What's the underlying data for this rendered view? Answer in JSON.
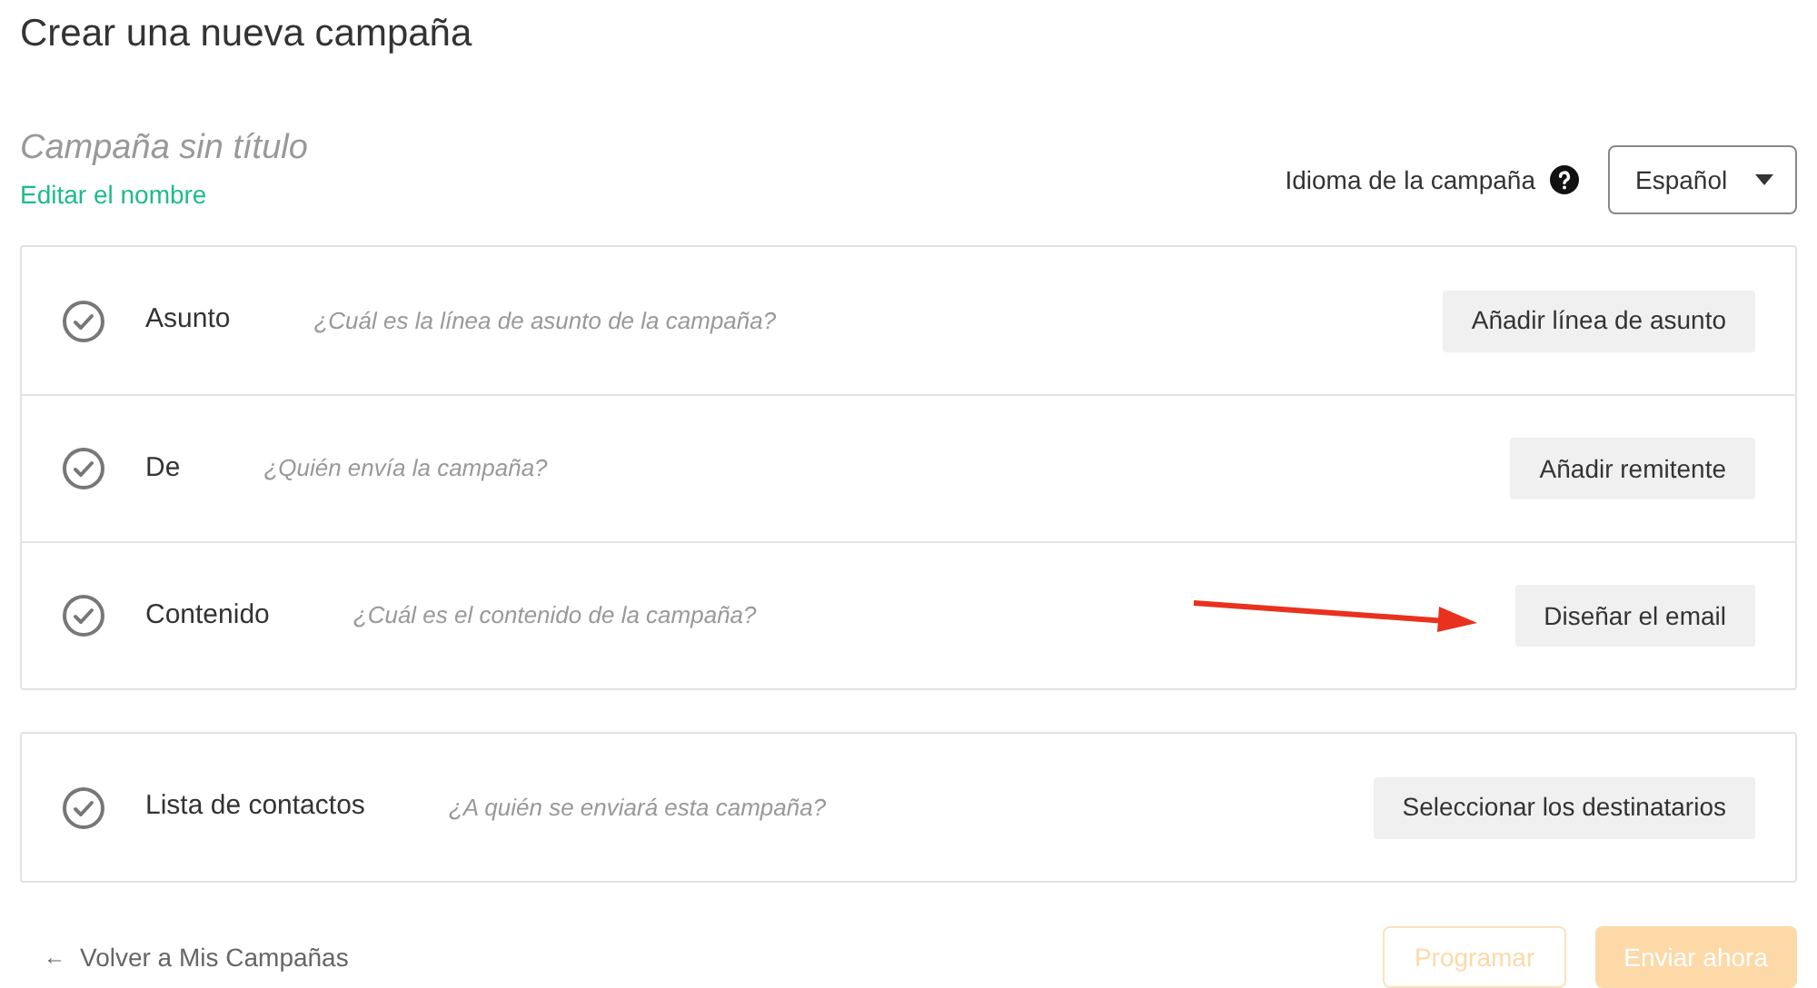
{
  "page_title": "Crear una nueva campaña",
  "campaign": {
    "name_placeholder": "Campaña sin título",
    "edit_link": "Editar el nombre"
  },
  "language": {
    "label": "Idioma de la campaña",
    "value": "Español"
  },
  "sections": [
    {
      "rows": [
        {
          "label": "Asunto",
          "hint": "¿Cuál es la línea de asunto de la campaña?",
          "button": "Añadir línea de asunto",
          "arrow": false
        },
        {
          "label": "De",
          "hint": "¿Quién envía la campaña?",
          "button": "Añadir remitente",
          "arrow": false
        },
        {
          "label": "Contenido",
          "hint": "¿Cuál es el contenido de la campaña?",
          "button": "Diseñar el email",
          "arrow": true
        }
      ]
    },
    {
      "rows": [
        {
          "label": "Lista de contactos",
          "hint": "¿A quién se enviará esta campaña?",
          "button": "Seleccionar los destinatarios",
          "arrow": false
        }
      ]
    }
  ],
  "footer": {
    "back_link": "Volver a Mis Campañas",
    "back_arrow": "←",
    "actions": [
      {
        "label": "Programar",
        "kind": "outline",
        "disabled": true
      },
      {
        "label": "Enviar ahora",
        "kind": "solid",
        "disabled": true
      }
    ]
  }
}
